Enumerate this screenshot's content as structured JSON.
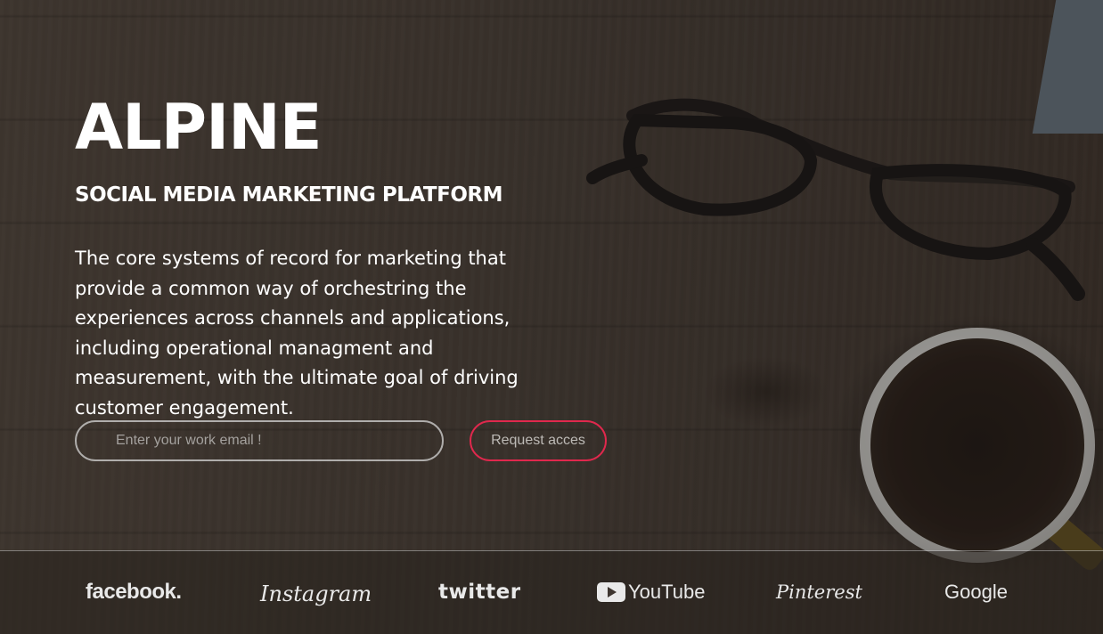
{
  "hero": {
    "title": "ALPINE",
    "subtitle": "SOCIAL MEDIA MARKETING PLATFORM",
    "description": "The core systems of record for marketing that provide a common way of orchestring the experiences across channels and applications, including operational managment and measurement, with the ultimate goal of driving customer engagement."
  },
  "signup": {
    "email_placeholder": "Enter your work email !",
    "email_value": "",
    "button_label": "Request acces"
  },
  "brands": {
    "facebook": "facebook.",
    "instagram": "Instagram",
    "twitter": "twitter",
    "youtube": "YouTube",
    "pinterest": "Pinterest",
    "google": "Google"
  },
  "colors": {
    "accent": "#e0284d",
    "text": "#ffffff",
    "brand_text": "#e9e9e9"
  },
  "icons": {
    "youtube": "youtube-play-icon"
  }
}
